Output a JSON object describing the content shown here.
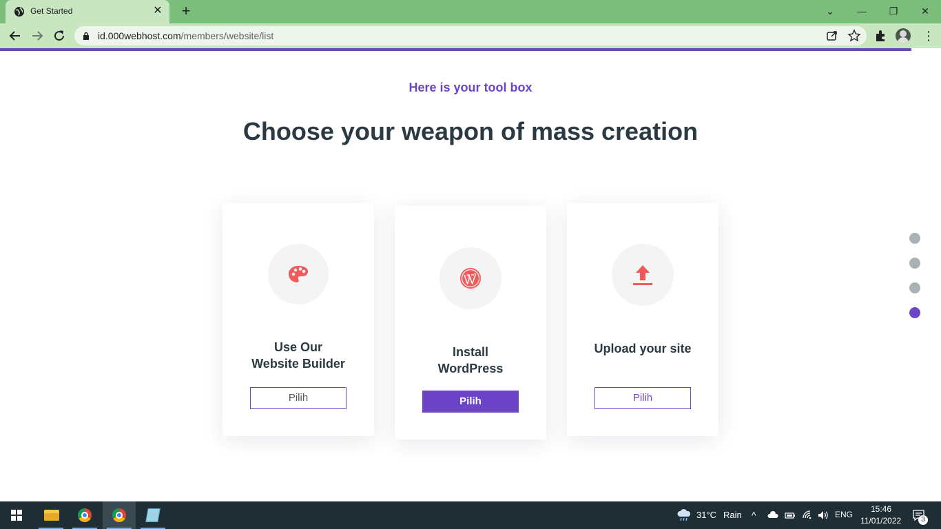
{
  "browser": {
    "tab_title": "Get Started",
    "url_host": "id.000webhost.com",
    "url_path": "/members/website/list"
  },
  "page": {
    "eyebrow": "Here is your tool box",
    "headline": "Choose your weapon of mass creation",
    "cards": [
      {
        "title_line1": "Use Our",
        "title_line2": "Website Builder",
        "button": "Pilih",
        "icon": "palette-icon"
      },
      {
        "title_line1": "Install",
        "title_line2": "WordPress",
        "button": "Pilih",
        "icon": "wordpress-icon"
      },
      {
        "title_line1": "Upload your site",
        "title_line2": "",
        "button": "Pilih",
        "icon": "upload-icon"
      }
    ],
    "pager_dots": 4,
    "active_dot": 4
  },
  "taskbar": {
    "weather_temp": "31°C",
    "weather_desc": "Rain",
    "language": "ENG",
    "time": "15:46",
    "date": "11/01/2022",
    "notifications": "3"
  },
  "colors": {
    "accent": "#6b44c8",
    "icon_red": "#f05a5a",
    "chrome_green": "#7bbd7a"
  }
}
